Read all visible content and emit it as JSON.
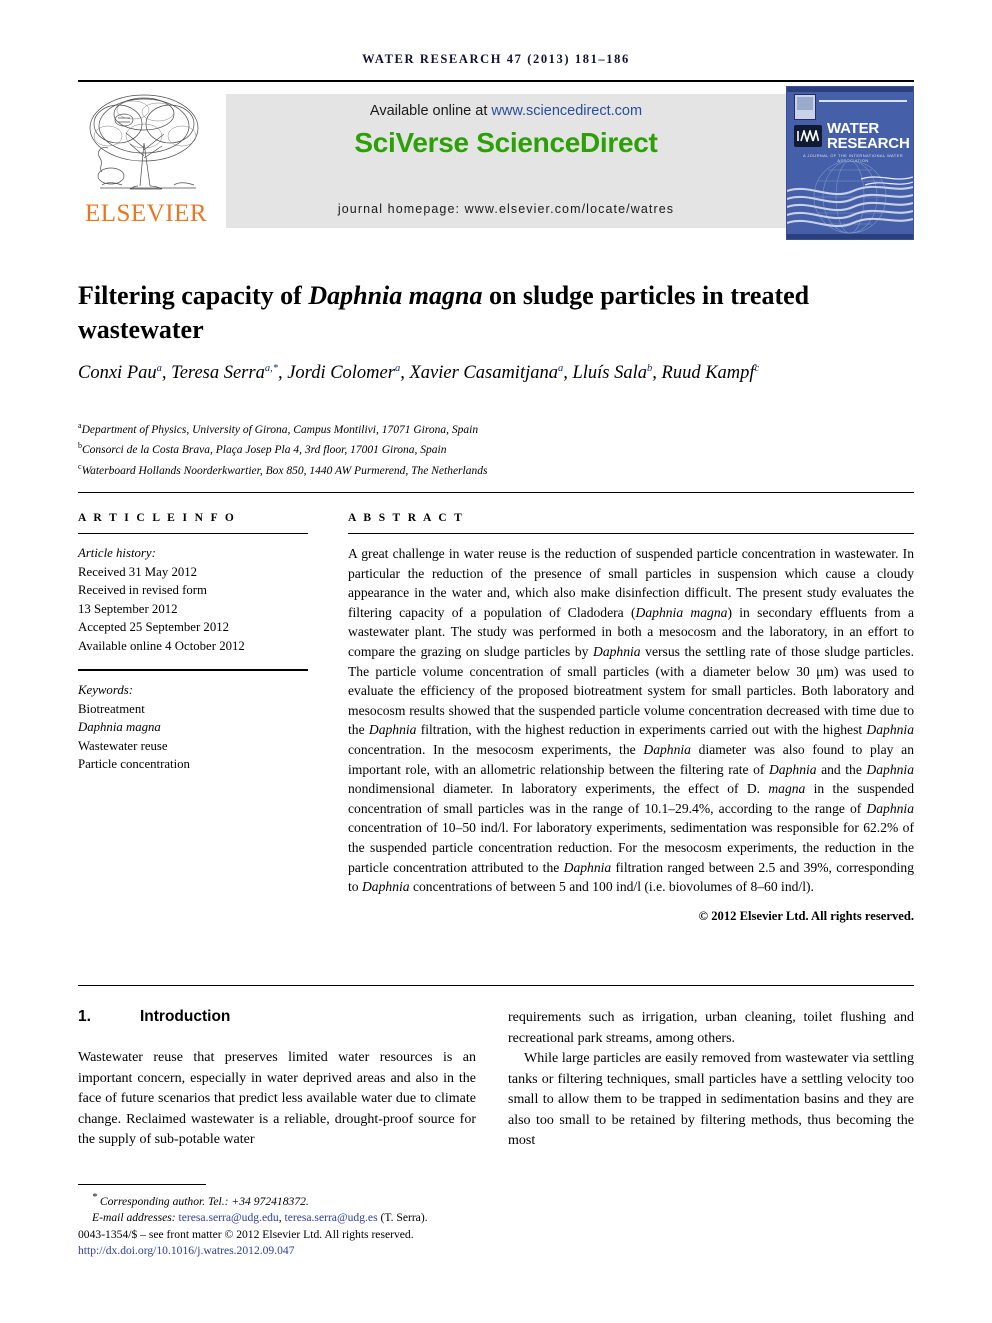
{
  "running_head": "WATER RESEARCH 47 (2013) 181–186",
  "banner": {
    "publisher_logo_word": "ELSEVIER",
    "available_prefix": "Available online at ",
    "available_url": "www.sciencedirect.com",
    "platform_title": "SciVerse ScienceDirect",
    "homepage": "journal homepage: www.elsevier.com/locate/watres",
    "journal_cover": {
      "title_line1": "WATER",
      "title_line2": "RESEARCH",
      "badge": "IWA",
      "subtitle": "A JOURNAL OF THE INTERNATIONAL WATER ASSOCIATION"
    }
  },
  "article": {
    "title_part1": "Filtering capacity of ",
    "title_italic": "Daphnia magna",
    "title_part2": " on sludge particles in treated wastewater",
    "authors": [
      {
        "name": "Conxi Pau",
        "sup": "a",
        "sep": ", "
      },
      {
        "name": "Teresa Serra",
        "sup": "a,*",
        "sep": ", "
      },
      {
        "name": "Jordi Colomer",
        "sup": "a",
        "sep": ", "
      },
      {
        "name": "Xavier Casamitjana",
        "sup": "a",
        "sep": ", "
      },
      {
        "name": "Lluís Sala",
        "sup": "b",
        "sep": ", "
      },
      {
        "name": "Ruud Kampf",
        "sup": "c",
        "sep": ""
      }
    ],
    "affiliations": [
      {
        "mark": "a",
        "text": "Department of Physics, University of Girona, Campus Montilivi, 17071 Girona, Spain"
      },
      {
        "mark": "b",
        "text": "Consorci de la Costa Brava, Plaça Josep Pla 4, 3rd floor, 17001 Girona, Spain"
      },
      {
        "mark": "c",
        "text": "Waterboard Hollands Noorderkwartier, Box 850, 1440 AW Purmerend, The Netherlands"
      }
    ]
  },
  "article_info": {
    "heading": "A R T I C L E   I N F O",
    "history_label": "Article history:",
    "history": [
      "Received 31 May 2012",
      "Received in revised form",
      "13 September 2012",
      "Accepted 25 September 2012",
      "Available online 4 October 2012"
    ],
    "keywords_label": "Keywords:",
    "keywords": [
      "Biotreatment",
      "Daphnia magna",
      "Wastewater reuse",
      "Particle concentration"
    ]
  },
  "abstract": {
    "heading": "A B S T R A C T",
    "text_segments": [
      {
        "t": "A great challenge in water reuse is the reduction of suspended particle concentration in wastewater. In particular the reduction of the presence of small particles in suspension which cause a cloudy appearance in the water and, which also make disinfection difficult. The present study evaluates the filtering capacity of a population of Cladodera (",
        "i": false
      },
      {
        "t": "Daphnia magna",
        "i": true
      },
      {
        "t": ") in secondary effluents from a wastewater plant. The study was performed in both a mesocosm and the laboratory, in an effort to compare the grazing on sludge particles by ",
        "i": false
      },
      {
        "t": "Daphnia",
        "i": true
      },
      {
        "t": " versus the settling rate of those sludge particles. The particle volume concentration of small particles (with a diameter below 30 μm) was used to evaluate the efficiency of the proposed biotreatment system for small particles. Both laboratory and mesocosm results showed that the suspended particle volume concentration decreased with time due to the ",
        "i": false
      },
      {
        "t": "Daphnia",
        "i": true
      },
      {
        "t": " filtration, with the highest reduction in experiments carried out with the highest ",
        "i": false
      },
      {
        "t": "Daphnia",
        "i": true
      },
      {
        "t": " concentration. In the mesocosm experiments, the ",
        "i": false
      },
      {
        "t": "Daphnia",
        "i": true
      },
      {
        "t": " diameter was also found to play an important role, with an allometric relationship between the filtering rate of ",
        "i": false
      },
      {
        "t": "Daphnia",
        "i": true
      },
      {
        "t": " and the ",
        "i": false
      },
      {
        "t": "Daphnia",
        "i": true
      },
      {
        "t": " nondimensional diameter. In laboratory experiments, the effect of D. ",
        "i": false
      },
      {
        "t": "magna",
        "i": true
      },
      {
        "t": " in the suspended concentration of small particles was in the range of 10.1–29.4%, according to the range of ",
        "i": false
      },
      {
        "t": "Daphnia",
        "i": true
      },
      {
        "t": " concentration of 10–50 ind/l. For laboratory experiments, sedimentation was responsible for 62.2% of the suspended particle concentration reduction. For the mesocosm experiments, the reduction in the particle concentration attributed to the ",
        "i": false
      },
      {
        "t": "Daphnia",
        "i": true
      },
      {
        "t": " filtration ranged between 2.5 and 39%, corresponding to ",
        "i": false
      },
      {
        "t": "Daphnia",
        "i": true
      },
      {
        "t": " concentrations of between 5 and 100 ind/l (i.e. biovolumes of 8–60 ind/l).",
        "i": false
      }
    ],
    "copyright": "© 2012 Elsevier Ltd. All rights reserved."
  },
  "introduction": {
    "number": "1.",
    "heading": "Introduction",
    "left_paragraph": "Wastewater reuse that preserves limited water resources is an important concern, especially in water deprived areas and also in the face of future scenarios that predict less available water due to climate change. Reclaimed wastewater is a reliable, drought-proof source for the supply of sub-potable water",
    "right_paragraph_1": "requirements such as irrigation, urban cleaning, toilet flushing and recreational park streams, among others.",
    "right_paragraph_2": "While large particles are easily removed from wastewater via settling tanks or filtering techniques, small particles have a settling velocity too small to allow them to be trapped in sedimentation basins and they are also too small to be retained by filtering methods, thus becoming the most"
  },
  "footnote": {
    "corresponding_marker": "*",
    "corresponding_text": "Corresponding author. Tel.: +34 972418372.",
    "email_label": "E-mail addresses:",
    "email_1": "teresa.serra@udg.edu",
    "email_sep": ", ",
    "email_2": "teresa.serra@udg.es",
    "email_suffix": " (T. Serra).",
    "issn_line": "0043-1354/$ – see front matter © 2012 Elsevier Ltd. All rights reserved.",
    "doi": "http://dx.doi.org/10.1016/j.watres.2012.09.047"
  },
  "colors": {
    "sciencedirect_green": "#2ca006",
    "elsevier_orange": "#E87722",
    "link_blue": "#2b3f9e",
    "cover_blue": "#4560a8"
  }
}
